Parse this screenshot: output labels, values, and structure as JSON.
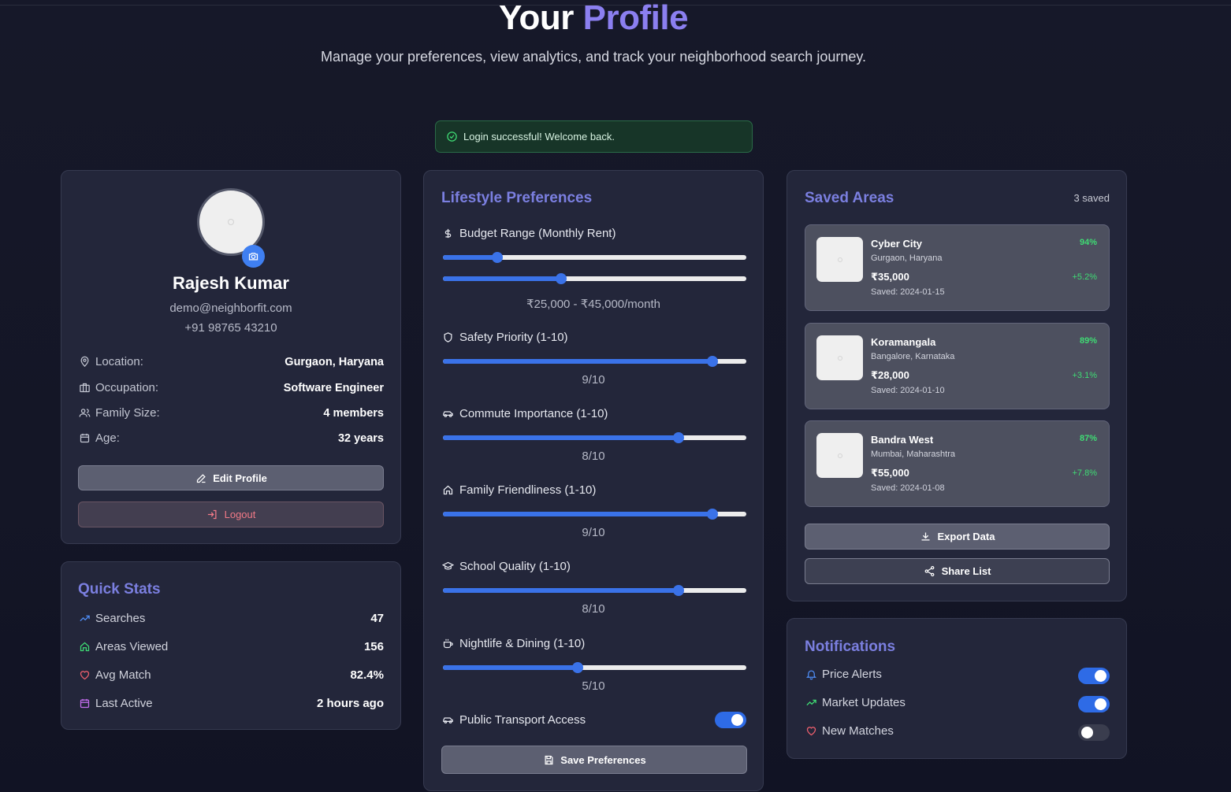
{
  "header": {
    "title_part1": "Your",
    "title_part2": "Profile",
    "subtitle": "Manage your preferences, view analytics, and track your neighborhood search journey."
  },
  "alert": {
    "message": "Login successful! Welcome back."
  },
  "profile": {
    "name": "Rajesh Kumar",
    "email": "demo@neighborfit.com",
    "phone": "+91 98765 43210",
    "fields": [
      {
        "label": "Location:",
        "value": "Gurgaon, Haryana",
        "icon": "map-pin-icon"
      },
      {
        "label": "Occupation:",
        "value": "Software Engineer",
        "icon": "briefcase-icon"
      },
      {
        "label": "Family Size:",
        "value": "4 members",
        "icon": "users-icon"
      },
      {
        "label": "Age:",
        "value": "32 years",
        "icon": "calendar-icon"
      }
    ],
    "edit_label": "Edit Profile",
    "logout_label": "Logout"
  },
  "quick_stats": {
    "title": "Quick Stats",
    "items": [
      {
        "label": "Searches",
        "value": "47",
        "icon": "trending-up-icon",
        "color": "#4f8ef7"
      },
      {
        "label": "Areas Viewed",
        "value": "156",
        "icon": "home-icon",
        "color": "#3fdc74"
      },
      {
        "label": "Avg Match",
        "value": "82.4%",
        "icon": "heart-icon",
        "color": "#f0606e"
      },
      {
        "label": "Last Active",
        "value": "2 hours ago",
        "icon": "calendar-icon",
        "color": "#c56ef0"
      }
    ]
  },
  "preferences": {
    "title": "Lifestyle Preferences",
    "budget": {
      "label": "Budget Range (Monthly Rent)",
      "min_fraction": 0.18,
      "max_fraction": 0.39,
      "display": "₹25,000 - ₹45,000/month"
    },
    "sliders": [
      {
        "label": "Safety Priority (1-10)",
        "value": 9,
        "display": "9/10",
        "icon": "shield-icon"
      },
      {
        "label": "Commute Importance (1-10)",
        "value": 8,
        "display": "8/10",
        "icon": "car-icon"
      },
      {
        "label": "Family Friendliness (1-10)",
        "value": 9,
        "display": "9/10",
        "icon": "home-icon"
      },
      {
        "label": "School Quality (1-10)",
        "value": 8,
        "display": "8/10",
        "icon": "graduation-cap-icon"
      },
      {
        "label": "Nightlife & Dining (1-10)",
        "value": 5,
        "display": "5/10",
        "icon": "coffee-icon"
      }
    ],
    "transport": {
      "label": "Public Transport Access",
      "enabled": true
    },
    "save_label": "Save Preferences"
  },
  "saved_areas": {
    "title": "Saved Areas",
    "count_label": "3 saved",
    "items": [
      {
        "name": "Cyber City",
        "location": "Gurgaon, Haryana",
        "price": "₹35,000",
        "saved": "Saved: 2024-01-15",
        "match": "94%",
        "change": "+5.2%"
      },
      {
        "name": "Koramangala",
        "location": "Bangalore, Karnataka",
        "price": "₹28,000",
        "saved": "Saved: 2024-01-10",
        "match": "89%",
        "change": "+3.1%"
      },
      {
        "name": "Bandra West",
        "location": "Mumbai, Maharashtra",
        "price": "₹55,000",
        "saved": "Saved: 2024-01-08",
        "match": "87%",
        "change": "+7.8%"
      }
    ],
    "export_label": "Export Data",
    "share_label": "Share List"
  },
  "notifications": {
    "title": "Notifications",
    "items": [
      {
        "label": "Price Alerts",
        "enabled": true,
        "icon": "bell-icon"
      },
      {
        "label": "Market Updates",
        "enabled": true,
        "icon": "trending-up-icon"
      },
      {
        "label": "New Matches",
        "enabled": false,
        "icon": "heart-icon"
      }
    ]
  },
  "colors": {
    "accent": "#7b7fe0",
    "slider": "#3a72e8",
    "success": "#3fdc74",
    "danger": "#f17a87"
  }
}
